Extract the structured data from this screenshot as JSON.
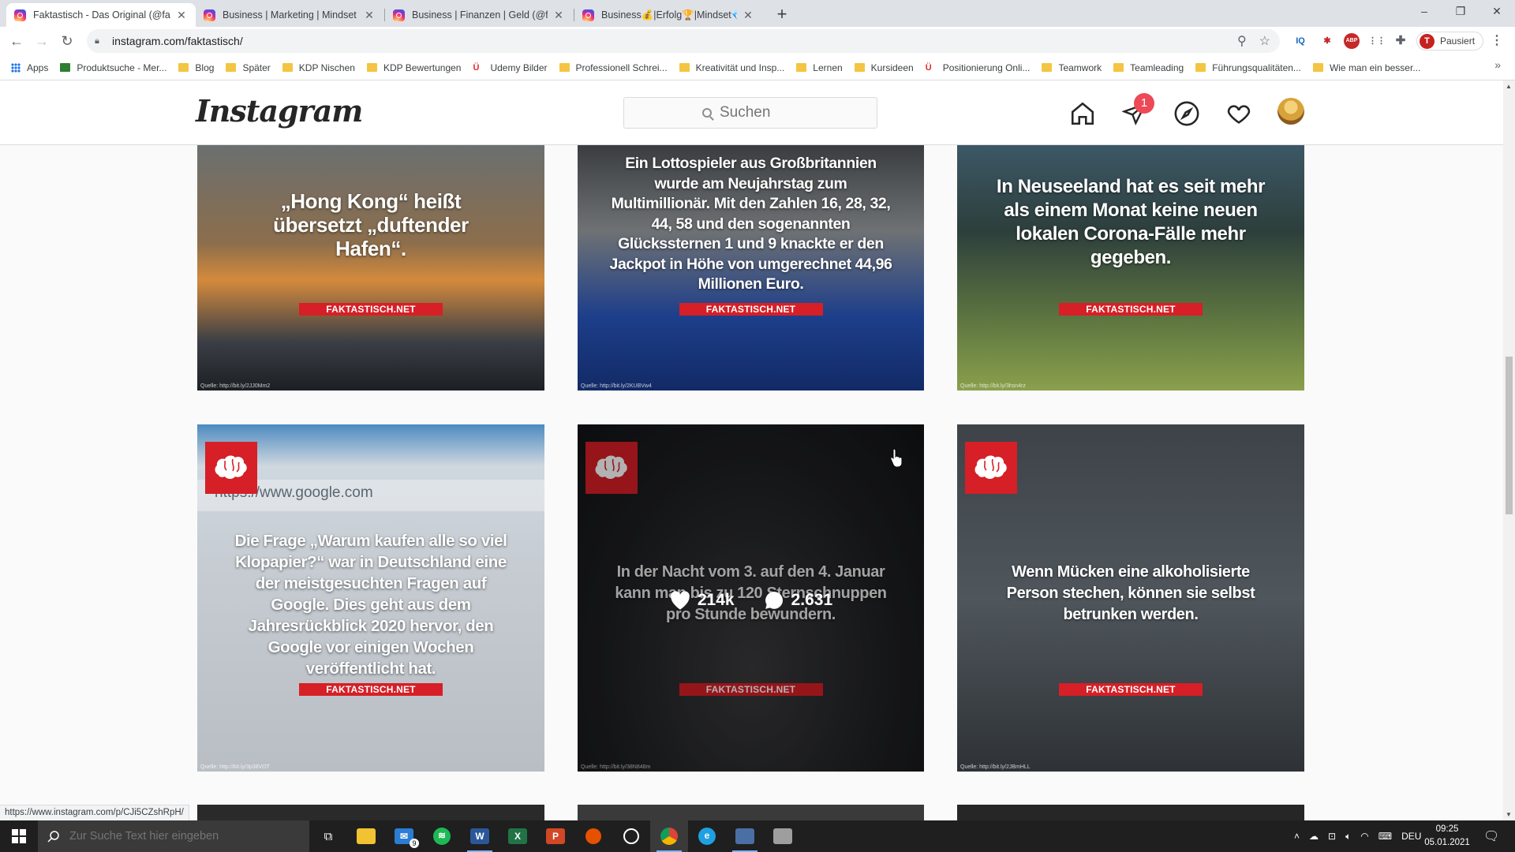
{
  "browser": {
    "tabs": [
      {
        "title": "Faktastisch - Das Original (@fakt",
        "active": true
      },
      {
        "title": "Business | Marketing | Mindset (@",
        "active": false
      },
      {
        "title": "Business | Finanzen | Geld (@fina",
        "active": false
      },
      {
        "title": "Business💰|Erfolg🏆|Mindset💎",
        "active": false
      }
    ],
    "new_tab": "+",
    "window_controls": {
      "minimize": "–",
      "restore": "❐",
      "close": "✕"
    },
    "url": "instagram.com/faktastisch/",
    "profile_initial": "T",
    "profile_status": "Pausiert",
    "bookmarks": [
      {
        "label": "Apps",
        "icon": "apps-grid-icon"
      },
      {
        "label": "Produktsuche - Mer...",
        "icon": "site-icon"
      },
      {
        "label": "Blog",
        "icon": "folder-icon"
      },
      {
        "label": "Später",
        "icon": "folder-icon"
      },
      {
        "label": "KDP Nischen",
        "icon": "folder-icon"
      },
      {
        "label": "KDP Bewertungen",
        "icon": "folder-icon"
      },
      {
        "label": "Udemy Bilder",
        "icon": "udemy-icon"
      },
      {
        "label": "Professionell Schrei...",
        "icon": "folder-icon"
      },
      {
        "label": "Kreativität und Insp...",
        "icon": "folder-icon"
      },
      {
        "label": "Lernen",
        "icon": "folder-icon"
      },
      {
        "label": "Kursideen",
        "icon": "folder-icon"
      },
      {
        "label": "Positionierung Onli...",
        "icon": "udemy-icon"
      },
      {
        "label": "Teamwork",
        "icon": "folder-icon"
      },
      {
        "label": "Teamleading",
        "icon": "folder-icon"
      },
      {
        "label": "Führungsqualitäten...",
        "icon": "folder-icon"
      },
      {
        "label": "Wie man ein besser...",
        "icon": "folder-icon"
      }
    ],
    "status_url": "https://www.instagram.com/p/CJi5CZshRpH/"
  },
  "instagram": {
    "logo": "Instagram",
    "search_placeholder": "Suchen",
    "direct_badge": "1",
    "brand_tag": "FAKTASTISCH.NET",
    "posts": [
      {
        "text": "„Hong Kong“ heißt übersetzt „duftender Hafen“.",
        "source": "Quelle: http://bit.ly/2JJ0Mm2"
      },
      {
        "text": "Ein Lottospieler aus Großbritannien wurde am Neujahrstag zum Multimillionär. Mit den Zahlen 16, 28, 32, 44, 58 und den sogenannten Glückssternen 1 und 9 knackte er den Jackpot in Höhe von umgerechnet 44,96 Millionen Euro.",
        "source": "Quelle: http://bit.ly/2KUBVw4"
      },
      {
        "text": "In Neuseeland hat es seit mehr als einem Monat keine neuen lokalen Corona-Fälle mehr gegeben.",
        "source": "Quelle: http://bit.ly/3hsn4rz"
      },
      {
        "text": "Die Frage „Warum kaufen alle so viel Klopapier?“ war in Deutschland eine der meistgesuchten Fragen auf Google. Dies geht aus dem Jahresrückblick 2020 hervor, den Google vor einigen Wochen veröffentlicht hat.",
        "source": "Quelle: http://bit.ly/3p38VOT",
        "bg_text": "https://www.google.com"
      },
      {
        "text": "In der Nacht vom 3. auf den 4. Januar kann man bis zu 120 Sternschnuppen pro Stunde bewundern.",
        "source": "Quelle: http://bit.ly/38N848m",
        "likes": "214k",
        "comments": "2.631"
      },
      {
        "text": "Wenn Mücken eine alkoholisierte Person stechen, können sie selbst betrunken werden.",
        "source": "Quelle: http://bit.ly/2JBmHLL"
      }
    ]
  },
  "taskbar": {
    "search_placeholder": "Zur Suche Text hier eingeben",
    "language": "DEU",
    "time": "09:25",
    "date": "05.01.2021",
    "mail_badge": "9"
  },
  "colors": {
    "brand_red": "#d61f26",
    "ig_badge": "#ed4956"
  }
}
